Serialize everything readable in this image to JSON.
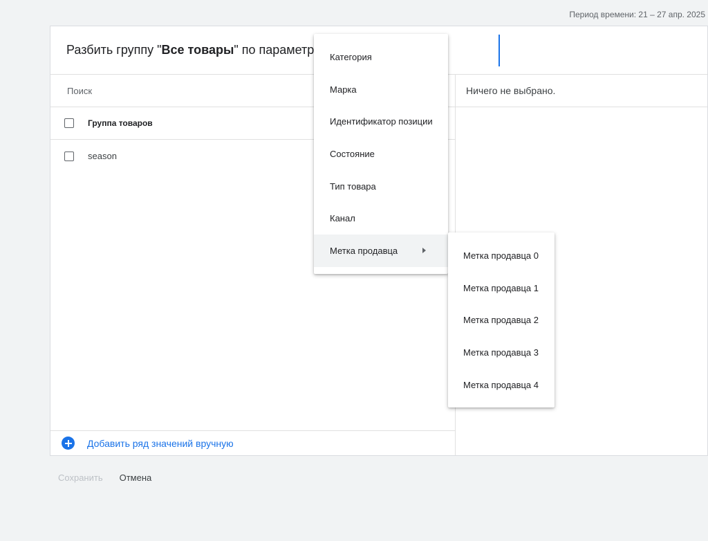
{
  "period": "Период времени: 21 – 27 апр. 2025",
  "header": {
    "prefix": "Разбить группу \"",
    "group": "Все товары",
    "suffix": "\" по параметру:"
  },
  "left": {
    "search_placeholder": "Поиск",
    "column_header": "Группа товаров",
    "rows": [
      "season"
    ],
    "add_row_label": "Добавить ряд значений вручную"
  },
  "right": {
    "empty_text": "Ничего не выбрано."
  },
  "footer": {
    "save_label": "Сохранить",
    "cancel_label": "Отмена"
  },
  "menu": {
    "items": [
      "Категория",
      "Марка",
      "Идентификатор позиции",
      "Состояние",
      "Тип товара",
      "Канал",
      "Метка продавца"
    ],
    "active_index": 6,
    "submenu": [
      "Метка продавца 0",
      "Метка продавца 1",
      "Метка продавца 2",
      "Метка продавца 3",
      "Метка продавца 4"
    ]
  },
  "colors": {
    "accent": "#1a73e8",
    "background": "#f1f3f4"
  }
}
